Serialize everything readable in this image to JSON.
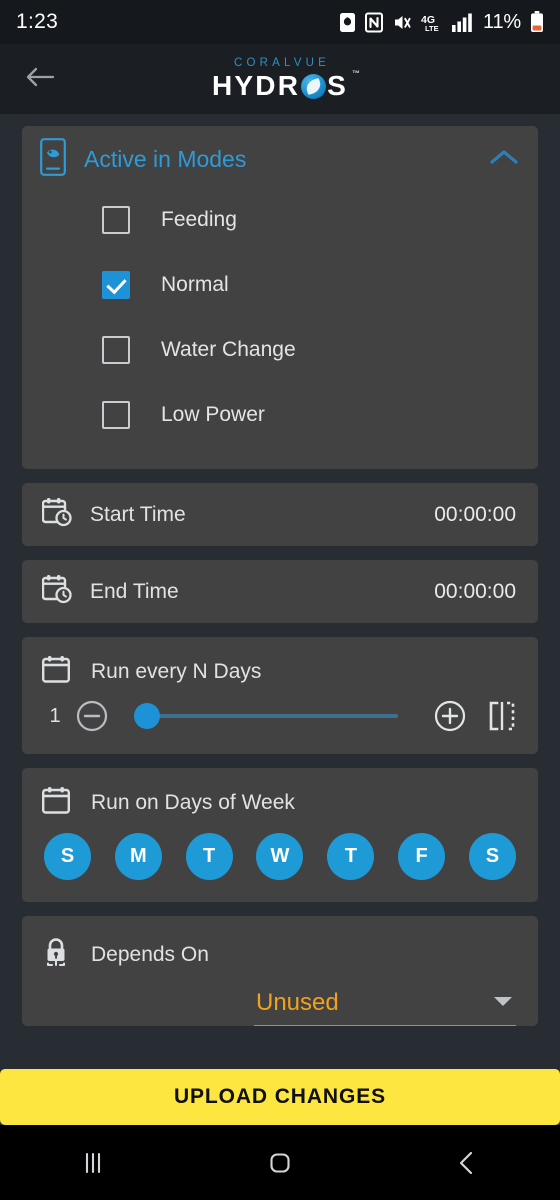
{
  "status_bar": {
    "time": "1:23",
    "battery_percent": "11%",
    "icons": [
      "battery-saver-icon",
      "nfc-icon",
      "mute-vibrate-icon",
      "4g-lte-icon",
      "signal-bars-icon",
      "battery-icon"
    ]
  },
  "app_bar": {
    "back_icon": "back-arrow-icon",
    "brand_top": "CORALVUE",
    "brand_main_1": "HYDR",
    "brand_main_2": "S",
    "trademark": "™"
  },
  "modes_card": {
    "icon": "device-aquarium-icon",
    "title": "Active in Modes",
    "collapse_icon": "chevron-up-icon",
    "items": [
      {
        "label": "Feeding",
        "checked": false
      },
      {
        "label": "Normal",
        "checked": true
      },
      {
        "label": "Water Change",
        "checked": false
      },
      {
        "label": "Low Power",
        "checked": false
      }
    ]
  },
  "start_time": {
    "icon": "calendar-clock-icon",
    "label": "Start Time",
    "value": "00:00:00"
  },
  "end_time": {
    "icon": "calendar-clock-icon",
    "label": "End Time",
    "value": "00:00:00"
  },
  "run_every_n_days": {
    "icon": "calendar-icon",
    "label": "Run every N Days",
    "value": "1",
    "minus_icon": "minus-circle-icon",
    "plus_icon": "plus-circle-icon",
    "copy_icon": "duplicate-brackets-icon",
    "slider_min": 1,
    "slider_max": 30,
    "slider_value": 1
  },
  "days_of_week": {
    "icon": "calendar-icon",
    "label": "Run on Days of Week",
    "days": [
      {
        "letter": "S",
        "name": "Sunday",
        "selected": true
      },
      {
        "letter": "M",
        "name": "Monday",
        "selected": true
      },
      {
        "letter": "T",
        "name": "Tuesday",
        "selected": true
      },
      {
        "letter": "W",
        "name": "Wednesday",
        "selected": true
      },
      {
        "letter": "T",
        "name": "Thursday",
        "selected": true
      },
      {
        "letter": "F",
        "name": "Friday",
        "selected": true
      },
      {
        "letter": "S",
        "name": "Saturday",
        "selected": true
      }
    ]
  },
  "depends_on": {
    "icon": "lock-dependency-icon",
    "label": "Depends On",
    "selected": "Unused",
    "dropdown_icon": "caret-down-icon"
  },
  "upload_button": {
    "label": "UPLOAD CHANGES"
  },
  "nav_bar": {
    "recents": "recents-icon",
    "home": "home-icon",
    "back": "back-icon"
  },
  "colors": {
    "accent_blue": "#1E92D7",
    "title_blue": "#2E9BD8",
    "brand_blue": "#2D8FC4",
    "card_bg": "#424242",
    "page_bg": "#282D33",
    "upload_yellow": "#FCE63F",
    "depends_orange": "#F0A21E"
  }
}
